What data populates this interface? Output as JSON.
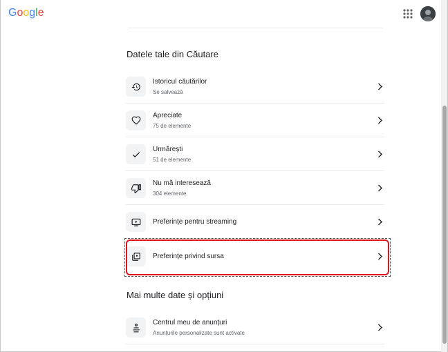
{
  "header": {
    "logo_letters": [
      "G",
      "o",
      "o",
      "g",
      "l",
      "e"
    ],
    "logo_colors": [
      "#4285F4",
      "#EA4335",
      "#FBBC05",
      "#4285F4",
      "#34A853",
      "#EA4335"
    ],
    "apps_icon": "grid-apps-icon",
    "avatar": "account-avatar"
  },
  "section_search_data": {
    "title": "Datele tale din Căutare",
    "items": [
      {
        "icon": "history-icon",
        "title": "Istoricul căutărilor",
        "subtitle": "Se salvează"
      },
      {
        "icon": "heart-icon",
        "title": "Apreciate",
        "subtitle": "75 de elemente"
      },
      {
        "icon": "check-icon",
        "title": "Urmărești",
        "subtitle": "51 de elemente"
      },
      {
        "icon": "thumb-down-icon",
        "title": "Nu mă interesează",
        "subtitle": "304 elemente"
      },
      {
        "icon": "streaming-icon",
        "title": "Preferințe pentru streaming"
      },
      {
        "icon": "source-icon",
        "title": "Preferințe privind sursa"
      }
    ]
  },
  "section_more": {
    "title": "Mai multe date și opțiuni",
    "items": [
      {
        "icon": "ad-center-icon",
        "title": "Centrul meu de anunțuri",
        "subtitle": "Anunțurile personalizate sunt activate"
      }
    ]
  },
  "highlight": {
    "item": "Preferințe privind sursa",
    "color": "#E0141C"
  }
}
